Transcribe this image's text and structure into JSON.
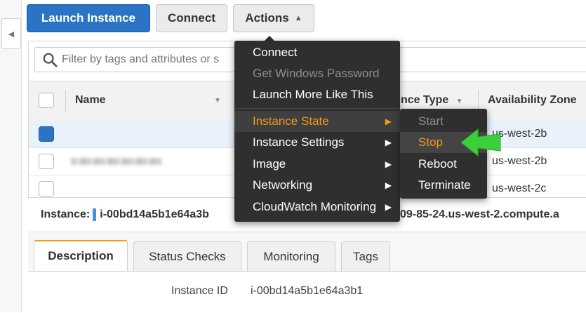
{
  "toolbar": {
    "launch_label": "Launch Instance",
    "connect_label": "Connect",
    "actions_label": "Actions"
  },
  "filter": {
    "placeholder": "Filter by tags and attributes or s"
  },
  "table": {
    "columns": [
      "Name",
      "nce Type",
      "Availability Zone"
    ],
    "rows": [
      {
        "name": "",
        "az": "us-west-2b",
        "selected": true
      },
      {
        "name": "(blurred)",
        "az": "us-west-2b",
        "selected": false
      },
      {
        "name": "",
        "az": "us-west-2c",
        "selected": false
      }
    ]
  },
  "instance": {
    "label": "Instance:",
    "id": "i-00bd14a5b1e64a3b",
    "dns_fragment": "09-85-24.us-west-2.compute.a"
  },
  "actions_menu": {
    "items": [
      {
        "label": "Connect",
        "disabled": false
      },
      {
        "label": "Get Windows Password",
        "disabled": true
      },
      {
        "label": "Launch More Like This",
        "disabled": false
      },
      {
        "label": "Instance State",
        "has_submenu": true,
        "highlighted": true
      },
      {
        "label": "Instance Settings",
        "has_submenu": true
      },
      {
        "label": "Image",
        "has_submenu": true
      },
      {
        "label": "Networking",
        "has_submenu": true
      },
      {
        "label": "CloudWatch Monitoring",
        "has_submenu": true
      }
    ]
  },
  "instance_state_menu": {
    "items": [
      {
        "label": "Start",
        "disabled": true
      },
      {
        "label": "Stop",
        "highlighted": true
      },
      {
        "label": "Reboot"
      },
      {
        "label": "Terminate"
      }
    ]
  },
  "tabs": [
    "Description",
    "Status Checks",
    "Monitoring",
    "Tags"
  ],
  "details": {
    "instance_id_label": "Instance ID",
    "instance_id_value": "i-00bd14a5b1e64a3b1"
  },
  "colors": {
    "primary": "#2b73c5",
    "menu_bg": "#2f2f2f",
    "highlight": "#f39a1e",
    "pointer": "#3ccf3c"
  },
  "icons": [
    "search-icon",
    "chevron-left-icon",
    "caret-up-icon",
    "caret-right-icon",
    "sort-caret-icon",
    "green-pointer-arrow-icon"
  ]
}
